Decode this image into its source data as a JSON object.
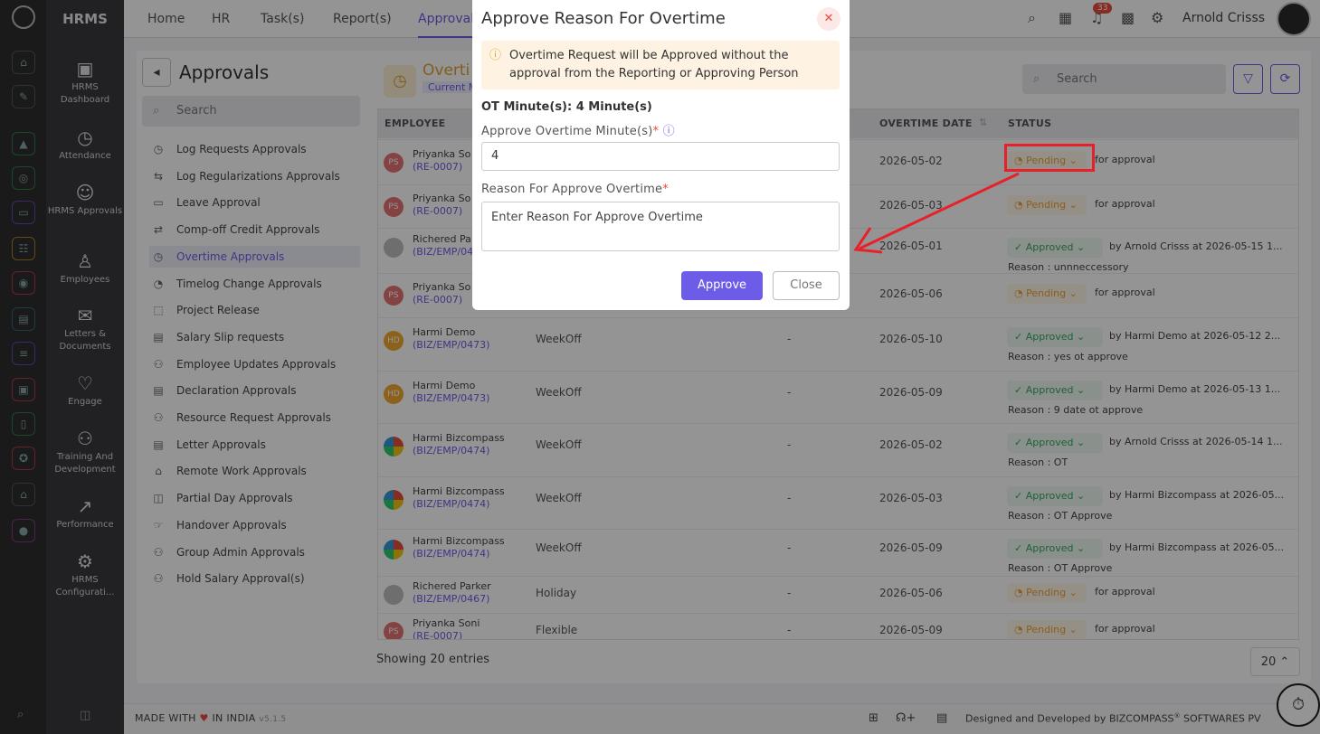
{
  "brand": "HRMS",
  "topnav": [
    "Home",
    "HR",
    "Task(s)",
    "Report(s)",
    "Approvals"
  ],
  "notification_count": "33",
  "user_name": "Arnold Crisss",
  "sidenav": [
    {
      "label": "HRMS Dashboard",
      "icon": "dashboard-icon"
    },
    {
      "label": "Attendance",
      "icon": "calendar-clock-icon"
    },
    {
      "label": "HRMS Approvals",
      "icon": "user-check-icon"
    },
    {
      "label": "Employees",
      "icon": "person-icon"
    },
    {
      "label": "Letters & Documents",
      "icon": "envelope-icon"
    },
    {
      "label": "Engage",
      "icon": "handshake-icon"
    },
    {
      "label": "Training And Development",
      "icon": "teacher-icon"
    },
    {
      "label": "Performance",
      "icon": "trend-icon"
    },
    {
      "label": "HRMS Configurati...",
      "icon": "gear-icon"
    }
  ],
  "page_title": "Approvals",
  "left_search_placeholder": "Search",
  "approval_menu": [
    "Log Requests Approvals",
    "Log Regularizations Approvals",
    "Leave Approval",
    "Comp-off Credit Approvals",
    "Overtime Approvals",
    "Timelog Change Approvals",
    "Project Release",
    "Salary Slip requests",
    "Employee Updates Approvals",
    "Declaration Approvals",
    "Resource Request Approvals",
    "Letter Approvals",
    "Remote Work Approvals",
    "Partial Day Approvals",
    "Handover Approvals",
    "Group Admin Approvals",
    "Hold Salary Approval(s)"
  ],
  "active_menu_index": 4,
  "section_title": "Overti",
  "section_tag": "Current M",
  "right_search_placeholder": "Search",
  "columns": {
    "employee": "EMPLOYEE",
    "overtime_date": "OVERTIME DATE",
    "status": "STATUS"
  },
  "rows": [
    {
      "name": "Priyanka So",
      "code": "(RE-0007)",
      "initials": "PS",
      "avatar_color": "#e57373",
      "type": "",
      "dash": "",
      "date": "2026-05-02",
      "status": "Pending",
      "note": "for approval",
      "reason": ""
    },
    {
      "name": "Priyanka So",
      "code": "(RE-0007)",
      "initials": "PS",
      "avatar_color": "#e57373",
      "type": "",
      "dash": "",
      "date": "2026-05-03",
      "status": "Pending",
      "note": "for approval",
      "reason": ""
    },
    {
      "name": "Richered Pa",
      "code": "(BIZ/EMP/04",
      "initials": "",
      "avatar_color": "#bdbdbd",
      "type": "",
      "dash": "",
      "date": "2026-05-01",
      "status": "Approved",
      "note": "by Arnold Crisss at 2026-05-15 1...",
      "reason": "Reason : unnneccessory"
    },
    {
      "name": "Priyanka So",
      "code": "(RE-0007)",
      "initials": "PS",
      "avatar_color": "#e57373",
      "type": "",
      "dash": "",
      "date": "2026-05-06",
      "status": "Pending",
      "note": "for approval",
      "reason": ""
    },
    {
      "name": "Harmi Demo",
      "code": "(BIZ/EMP/0473)",
      "initials": "HD",
      "avatar_color": "#f0a830",
      "type": "WeekOff",
      "dash": "-",
      "date": "2026-05-10",
      "status": "Approved",
      "note": "by Harmi Demo at 2026-05-12 2...",
      "reason": "Reason : yes ot approve"
    },
    {
      "name": "Harmi Demo",
      "code": "(BIZ/EMP/0473)",
      "initials": "HD",
      "avatar_color": "#f0a830",
      "type": "WeekOff",
      "dash": "-",
      "date": "2026-05-09",
      "status": "Approved",
      "note": "by Harmi Demo at 2026-05-13 1...",
      "reason": "Reason : 9 date ot approve"
    },
    {
      "name": "Harmi Bizcompass",
      "code": "(BIZ/EMP/0474)",
      "initials": "",
      "avatar_color": "pinwheel",
      "type": "WeekOff",
      "dash": "-",
      "date": "2026-05-02",
      "status": "Approved",
      "note": "by Arnold Crisss at 2026-05-14 1...",
      "reason": "Reason : OT"
    },
    {
      "name": "Harmi Bizcompass",
      "code": "(BIZ/EMP/0474)",
      "initials": "",
      "avatar_color": "pinwheel",
      "type": "WeekOff",
      "dash": "-",
      "date": "2026-05-03",
      "status": "Approved",
      "note": "by Harmi Bizcompass at 2026-05...",
      "reason": "Reason : OT Approve"
    },
    {
      "name": "Harmi Bizcompass",
      "code": "(BIZ/EMP/0474)",
      "initials": "",
      "avatar_color": "pinwheel",
      "type": "WeekOff",
      "dash": "-",
      "date": "2026-05-09",
      "status": "Approved",
      "note": "by Harmi Bizcompass at 2026-05...",
      "reason": "Reason : OT Approve"
    },
    {
      "name": "Richered Parker",
      "code": "(BIZ/EMP/0467)",
      "initials": "",
      "avatar_color": "#bdbdbd",
      "type": "Holiday",
      "dash": "-",
      "date": "2026-05-06",
      "status": "Pending",
      "note": "for approval",
      "reason": ""
    },
    {
      "name": "Priyanka Soni",
      "code": "(RE-0007)",
      "initials": "PS",
      "avatar_color": "#e57373",
      "type": "Flexible",
      "dash": "-",
      "date": "2026-05-09",
      "status": "Pending",
      "note": "for approval",
      "reason": ""
    }
  ],
  "entries_text": "Showing 20 entries",
  "page_size": "20",
  "footer_made": "MADE WITH",
  "footer_india": "IN INDIA",
  "footer_version": "v5.1.5",
  "footer_designed": "Designed and Developed by",
  "footer_company": "BIZCOMPASS",
  "footer_company_tail": "SOFTWARES PV",
  "modal": {
    "title": "Approve Reason For Overtime",
    "alert": "Overtime Request will be Approved without the approval from the Reporting or Approving Person",
    "ot_minutes": "OT Minute(s): 4 Minute(s)",
    "minutes_label": "Approve Overtime Minute(s)",
    "minutes_value": "4",
    "reason_label": "Reason For Approve Overtime",
    "reason_placeholder": "Enter Reason For Approve Overtime",
    "approve_label": "Approve",
    "close_label": "Close"
  },
  "colors": {
    "accent": "#6c5ce7",
    "pending": "#f0a030",
    "approved": "#3aa45c",
    "annotation": "#e8202a"
  }
}
